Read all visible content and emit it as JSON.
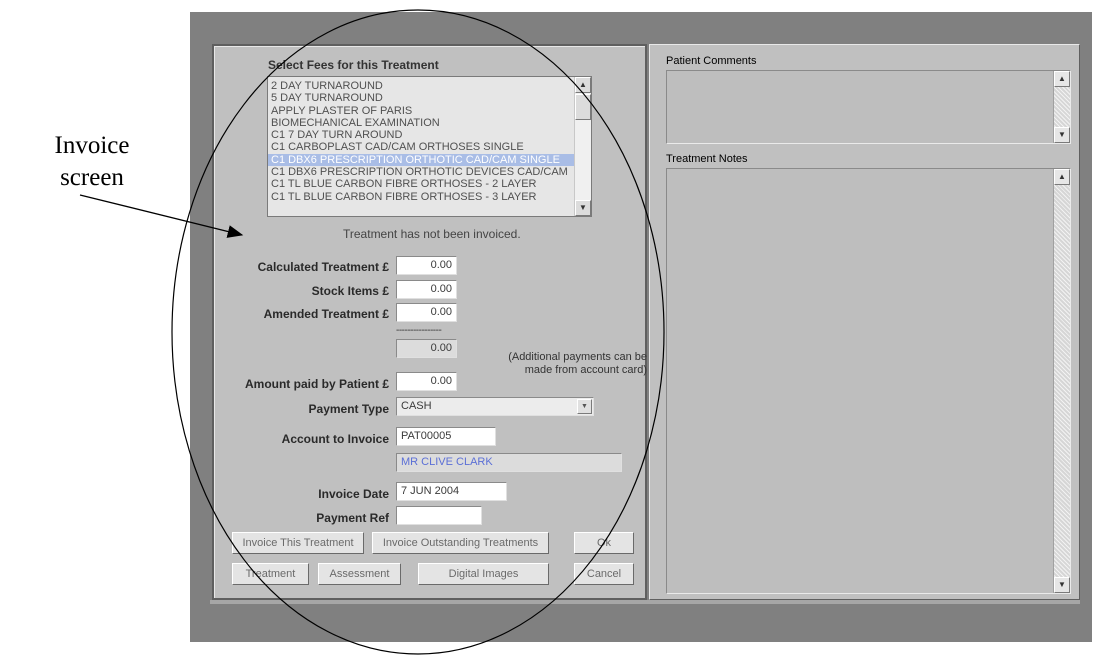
{
  "annotation": {
    "line1": "Invoice",
    "line2": "screen"
  },
  "fees": {
    "title": "Select Fees for this Treatment",
    "items": [
      "2 DAY TURNAROUND",
      "5 DAY TURNAROUND",
      "APPLY PLASTER OF PARIS",
      "BIOMECHANICAL EXAMINATION",
      "C1 7 DAY TURN AROUND",
      "C1 CARBOPLAST CAD/CAM ORTHOSES SINGLE",
      "C1 DBX6 PRESCRIPTION ORTHOTIC CAD/CAM SINGLE",
      "C1 DBX6 PRESCRIPTION ORTHOTIC DEVICES CAD/CAM",
      "C1 TL BLUE CARBON FIBRE ORTHOSES - 2 LAYER",
      "C1 TL BLUE CARBON FIBRE ORTHOSES - 3 LAYER"
    ],
    "selected_index": 6
  },
  "status_text": "Treatment has not been invoiced.",
  "calculated_treatment": {
    "label": "Calculated Treatment £",
    "value": "0.00"
  },
  "stock_items": {
    "label": "Stock Items £",
    "value": "0.00"
  },
  "amended_treatment": {
    "label": "Amended Treatment £",
    "value": "0.00"
  },
  "separator": "----------------",
  "total": {
    "value": "0.00"
  },
  "additional_note": "(Additional payments can be made from account card)",
  "amount_paid": {
    "label": "Amount paid by Patient £",
    "value": "0.00"
  },
  "payment_type": {
    "label": "Payment Type",
    "value": "CASH"
  },
  "account": {
    "label": "Account to Invoice",
    "value": "PAT00005",
    "name": "MR CLIVE CLARK"
  },
  "invoice_date": {
    "label": "Invoice Date",
    "value": "7 JUN 2004"
  },
  "payment_ref": {
    "label": "Payment Ref",
    "value": ""
  },
  "buttons": {
    "invoice_this": "Invoice This Treatment",
    "invoice_outstanding": "Invoice Outstanding Treatments",
    "ok": "Ok",
    "treatment": "Treatment",
    "assessment": "Assessment",
    "digital_images": "Digital Images",
    "cancel": "Cancel"
  },
  "patient_comments": {
    "label": "Patient Comments"
  },
  "treatment_notes": {
    "label": "Treatment Notes"
  },
  "colors": {
    "selection": "#a9bde6",
    "name_text": "#5b6fd6",
    "app_bg": "#808080"
  }
}
